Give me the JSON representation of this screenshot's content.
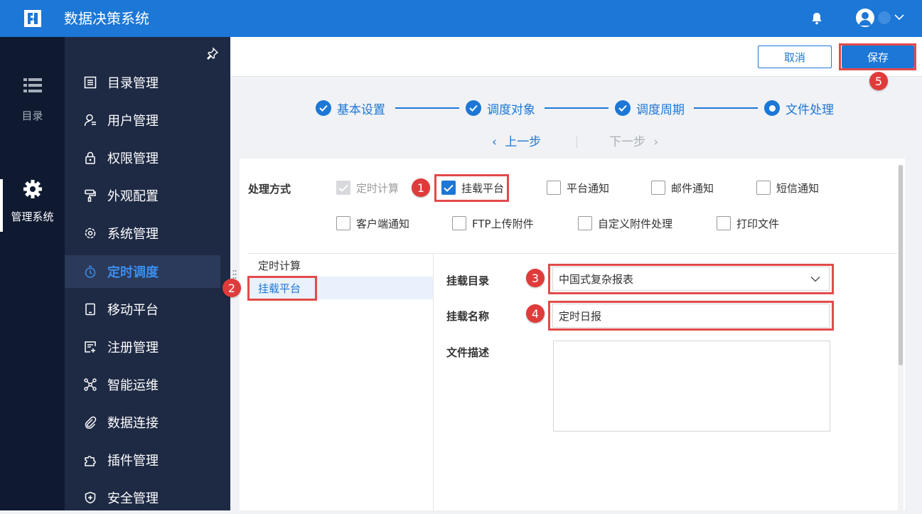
{
  "header": {
    "app_title": "数据决策系统",
    "icons": [
      "logo-icon",
      "bell-icon",
      "user-avatar-icon",
      "chevron-down-icon"
    ]
  },
  "rail": {
    "items": [
      {
        "label": "目录",
        "icon": "list-icon"
      },
      {
        "label": "管理系统",
        "icon": "gear-icon",
        "active": true
      }
    ]
  },
  "sidebar": {
    "items": [
      {
        "label": "目录管理",
        "icon": "catalog-icon"
      },
      {
        "label": "用户管理",
        "icon": "user-icon"
      },
      {
        "label": "权限管理",
        "icon": "lock-icon"
      },
      {
        "label": "外观配置",
        "icon": "paint-roller-icon"
      },
      {
        "label": "系统管理",
        "icon": "settings-icon"
      },
      {
        "label": "定时调度",
        "icon": "timer-icon",
        "active": true
      },
      {
        "label": "移动平台",
        "icon": "tablet-icon"
      },
      {
        "label": "注册管理",
        "icon": "register-icon"
      },
      {
        "label": "智能运维",
        "icon": "network-icon"
      },
      {
        "label": "数据连接",
        "icon": "paperclip-icon"
      },
      {
        "label": "插件管理",
        "icon": "puzzle-icon"
      },
      {
        "label": "安全管理",
        "icon": "shield-icon"
      }
    ]
  },
  "actions": {
    "cancel": "取消",
    "save": "保存"
  },
  "steps": [
    {
      "label": "基本设置",
      "state": "done"
    },
    {
      "label": "调度对象",
      "state": "done"
    },
    {
      "label": "调度周期",
      "state": "done"
    },
    {
      "label": "文件处理",
      "state": "current"
    }
  ],
  "nav": {
    "prev": "上一步",
    "next": "下一步"
  },
  "processing": {
    "label": "处理方式",
    "options": [
      {
        "label": "定时计算",
        "checked": true,
        "disabled": true
      },
      {
        "label": "挂载平台",
        "checked": true
      },
      {
        "label": "平台通知",
        "checked": false
      },
      {
        "label": "邮件通知",
        "checked": false
      },
      {
        "label": "短信通知",
        "checked": false
      },
      {
        "label": "客户端通知",
        "checked": false
      },
      {
        "label": "FTP上传附件",
        "checked": false
      },
      {
        "label": "自定义附件处理",
        "checked": false
      },
      {
        "label": "打印文件",
        "checked": false
      }
    ]
  },
  "list": {
    "items": [
      "定时计算",
      "挂载平台"
    ],
    "selected": "挂载平台"
  },
  "form": {
    "mount_dir_label": "挂载目录",
    "mount_dir_value": "中国式复杂报表",
    "mount_name_label": "挂载名称",
    "mount_name_value": "定时日报",
    "desc_label": "文件描述",
    "desc_value": ""
  },
  "badges": [
    "1",
    "2",
    "3",
    "4",
    "5"
  ],
  "colors": {
    "primary": "#1c77d6",
    "highlight": "#e34a4a",
    "sidebar": "#1e2a44",
    "rail": "#0f1a31"
  }
}
